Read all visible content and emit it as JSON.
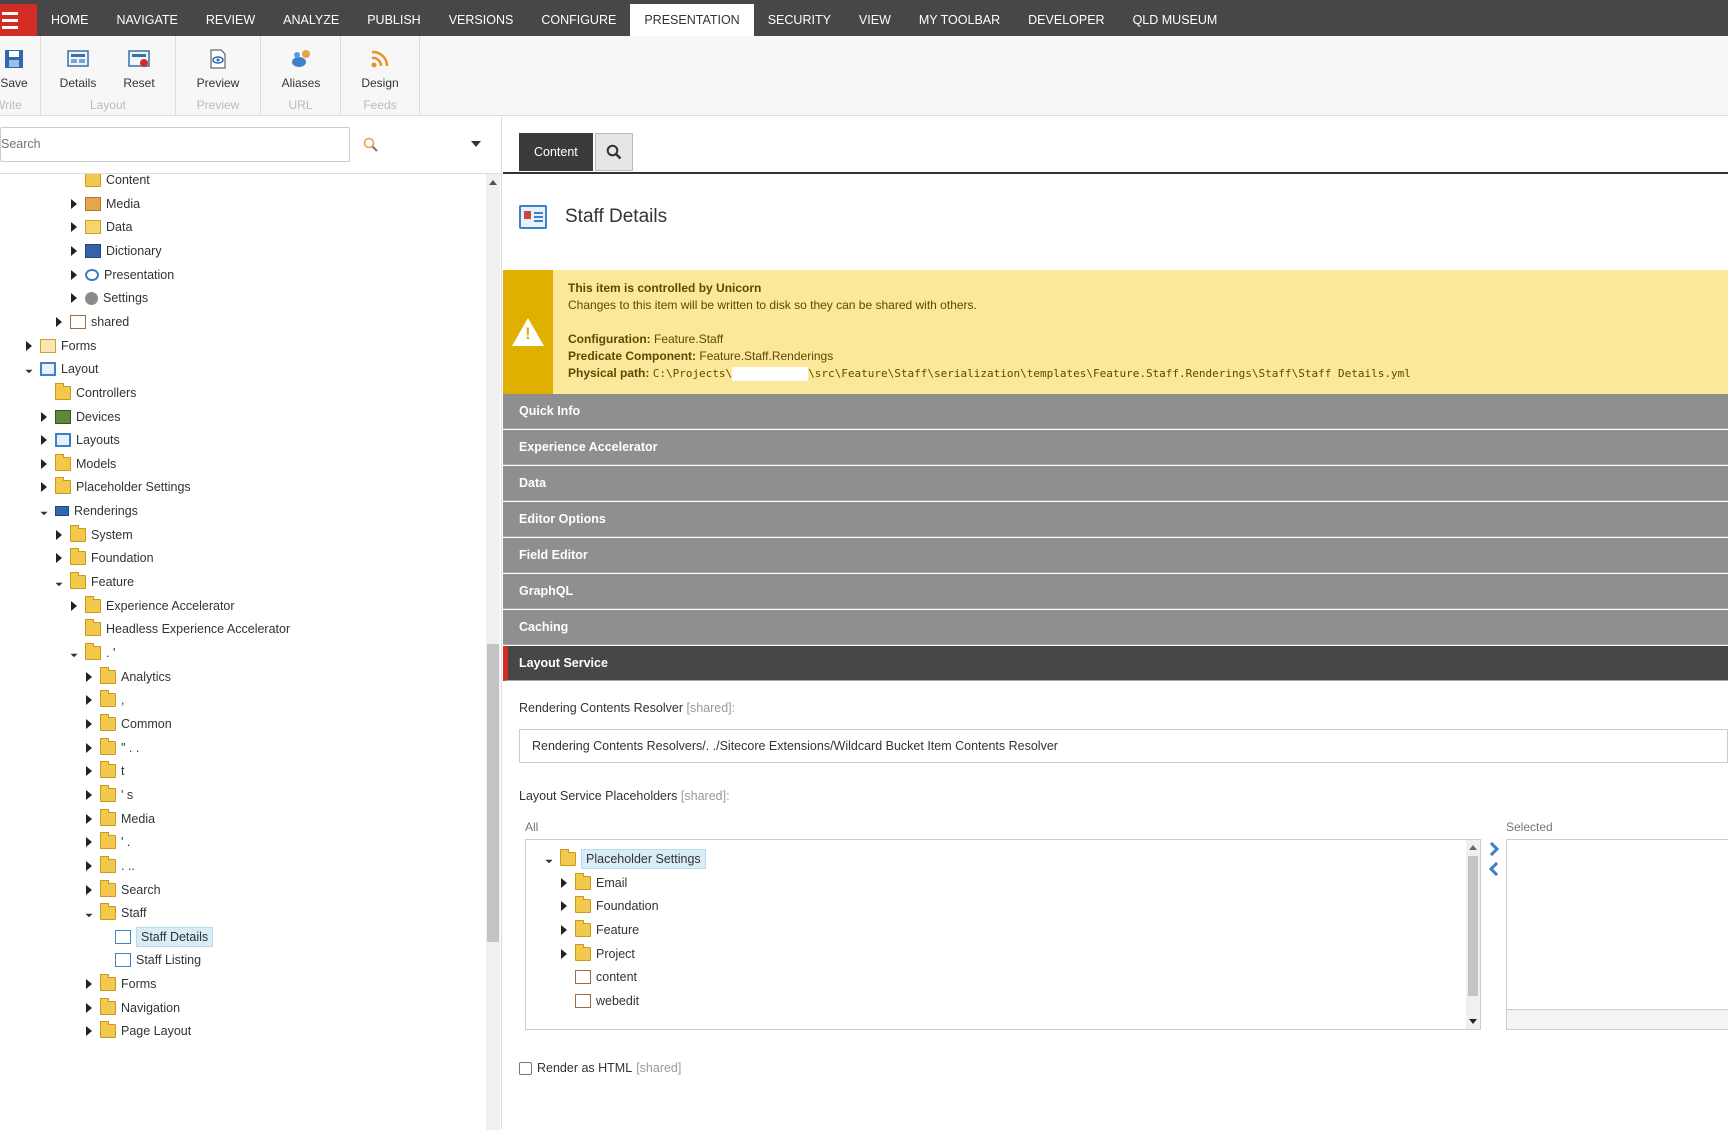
{
  "menu": {
    "tabs": [
      "HOME",
      "NAVIGATE",
      "REVIEW",
      "ANALYZE",
      "PUBLISH",
      "VERSIONS",
      "CONFIGURE",
      "PRESENTATION",
      "SECURITY",
      "VIEW",
      "MY TOOLBAR",
      "DEVELOPER",
      "QLD MUSEUM"
    ],
    "active_tab": "PRESENTATION"
  },
  "ribbon": {
    "save": "Save",
    "write": "Write",
    "details": "Details",
    "reset": "Reset",
    "layout_group": "Layout",
    "preview": "Preview",
    "preview_group": "Preview",
    "aliases": "Aliases",
    "url_group": "URL",
    "design": "Design",
    "feeds_group": "Feeds"
  },
  "search": {
    "placeholder": "Search"
  },
  "tree": [
    {
      "label": "Content",
      "indent": 5,
      "exp": "none",
      "icon": "fold"
    },
    {
      "label": "Media",
      "indent": 5,
      "exp": "closed",
      "icon": "media"
    },
    {
      "label": "Data",
      "indent": 5,
      "exp": "closed",
      "icon": "data"
    },
    {
      "label": "Dictionary",
      "indent": 5,
      "exp": "closed",
      "icon": "dict"
    },
    {
      "label": "Presentation",
      "indent": 5,
      "exp": "closed",
      "icon": "eye"
    },
    {
      "label": "Settings",
      "indent": 5,
      "exp": "closed",
      "icon": "gear"
    },
    {
      "label": "shared",
      "indent": 4,
      "exp": "closed",
      "icon": "shared"
    },
    {
      "label": "Forms",
      "indent": 2,
      "exp": "closed",
      "icon": "forms"
    },
    {
      "label": "Layout",
      "indent": 2,
      "exp": "open",
      "icon": "layoutico"
    },
    {
      "label": "Controllers",
      "indent": 3,
      "exp": "none",
      "icon": "fold"
    },
    {
      "label": "Devices",
      "indent": 3,
      "exp": "closed",
      "icon": "device"
    },
    {
      "label": "Layouts",
      "indent": 3,
      "exp": "closed",
      "icon": "layoutico"
    },
    {
      "label": "Models",
      "indent": 3,
      "exp": "closed",
      "icon": "fold"
    },
    {
      "label": "Placeholder Settings",
      "indent": 3,
      "exp": "closed",
      "icon": "fold"
    },
    {
      "label": "Renderings",
      "indent": 3,
      "exp": "open",
      "icon": "render"
    },
    {
      "label": "System",
      "indent": 4,
      "exp": "closed",
      "icon": "fold"
    },
    {
      "label": "Foundation",
      "indent": 4,
      "exp": "closed",
      "icon": "fold"
    },
    {
      "label": "Feature",
      "indent": 4,
      "exp": "open",
      "icon": "fold"
    },
    {
      "label": "Experience Accelerator",
      "indent": 5,
      "exp": "closed",
      "icon": "fold"
    },
    {
      "label": "Headless Experience Accelerator",
      "indent": 5,
      "exp": "none",
      "icon": "fold"
    },
    {
      "label": ". '",
      "indent": 5,
      "exp": "open",
      "icon": "fold"
    },
    {
      "label": "Analytics",
      "indent": 6,
      "exp": "closed",
      "icon": "fold"
    },
    {
      "label": "           ,",
      "indent": 6,
      "exp": "closed",
      "icon": "fold"
    },
    {
      "label": "Common",
      "indent": 6,
      "exp": "closed",
      "icon": "fold"
    },
    {
      "label": "\" . .",
      "indent": 6,
      "exp": "closed",
      "icon": "fold"
    },
    {
      "label": "t",
      "indent": 6,
      "exp": "closed",
      "icon": "fold"
    },
    {
      "label": "'       s",
      "indent": 6,
      "exp": "closed",
      "icon": "fold"
    },
    {
      "label": "Media",
      "indent": 6,
      "exp": "closed",
      "icon": "fold"
    },
    {
      "label": "'      .",
      "indent": 6,
      "exp": "closed",
      "icon": "fold"
    },
    {
      "label": ". ..",
      "indent": 6,
      "exp": "closed",
      "icon": "fold"
    },
    {
      "label": "Search",
      "indent": 6,
      "exp": "closed",
      "icon": "fold"
    },
    {
      "label": "Staff",
      "indent": 6,
      "exp": "open",
      "icon": "fold"
    },
    {
      "label": "Staff Details",
      "indent": 7,
      "exp": "none",
      "icon": "staffico",
      "selected": true
    },
    {
      "label": "Staff Listing",
      "indent": 7,
      "exp": "none",
      "icon": "staffico"
    },
    {
      "label": "Forms",
      "indent": 6,
      "exp": "closed",
      "icon": "fold"
    },
    {
      "label": "Navigation",
      "indent": 6,
      "exp": "closed",
      "icon": "fold"
    },
    {
      "label": "Page Layout",
      "indent": 6,
      "exp": "closed",
      "icon": "fold"
    }
  ],
  "content": {
    "tab_label": "Content",
    "item_title": "Staff Details",
    "warning": {
      "title": "This item is controlled by Unicorn",
      "subtitle": "Changes to this item will be written to disk so they can be shared with others.",
      "config_label": "Configuration:",
      "config_value": "Feature.Staff",
      "predicate_label": "Predicate Component:",
      "predicate_value": "Feature.Staff.Renderings",
      "path_label": "Physical path:",
      "path_prefix": "C:\\Projects\\",
      "path_suffix": "\\src\\Feature\\Staff\\serialization\\templates\\Feature.Staff.Renderings\\Staff\\Staff Details.yml"
    },
    "sections": [
      "Quick Info",
      "Experience Accelerator",
      "Data",
      "Editor Options",
      "Field Editor",
      "GraphQL",
      "Caching",
      "Layout Service"
    ],
    "active_section": "Layout Service",
    "resolver_label": "Rendering Contents Resolver",
    "resolver_value": "Rendering Contents Resolvers/.    ./Sitecore Extensions/Wildcard Bucket Item Contents Resolver",
    "placeholders_label": "Layout Service Placeholders",
    "shared_tag": "[shared]:",
    "all_label": "All",
    "selected_label": "Selected",
    "placeholder_tree": [
      {
        "label": "Placeholder Settings",
        "indent": 0,
        "exp": "open",
        "icon": "fold",
        "selected": true
      },
      {
        "label": "Email",
        "indent": 1,
        "exp": "closed",
        "icon": "fold"
      },
      {
        "label": "Foundation",
        "indent": 1,
        "exp": "closed",
        "icon": "fold"
      },
      {
        "label": "Feature",
        "indent": 1,
        "exp": "closed",
        "icon": "fold"
      },
      {
        "label": "Project",
        "indent": 1,
        "exp": "closed",
        "icon": "fold"
      },
      {
        "label": "content",
        "indent": 1,
        "exp": "none",
        "icon": "shared"
      },
      {
        "label": "webedit",
        "indent": 1,
        "exp": "none",
        "icon": "shared"
      }
    ],
    "render_html_label": "Render as HTML",
    "render_html_shared": "[shared]"
  }
}
